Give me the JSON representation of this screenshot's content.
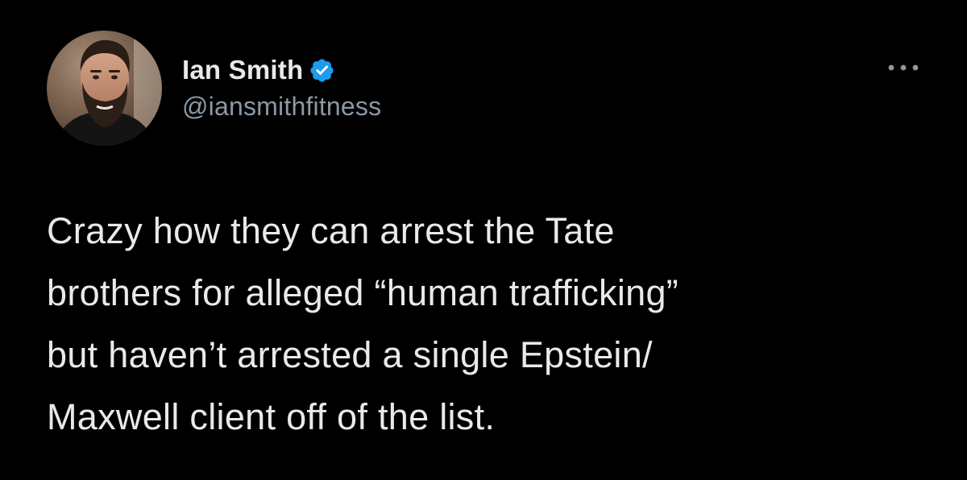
{
  "tweet": {
    "author": {
      "name": "Ian Smith",
      "handle": "@iansmithfitness",
      "verified": true,
      "avatar_icon": "profile-photo-bearded-man"
    },
    "more_icon": "more-options-icon",
    "text_lines": [
      "Crazy how they can arrest the Tate",
      "brothers for alleged “human trafficking”",
      "but haven’t arrested a single Epstein/",
      "Maxwell client off of the list."
    ]
  },
  "colors": {
    "background": "#000000",
    "primary_text": "#e7e9ea",
    "secondary_text": "#8b98a5",
    "verified_badge": "#1d9bf0"
  }
}
